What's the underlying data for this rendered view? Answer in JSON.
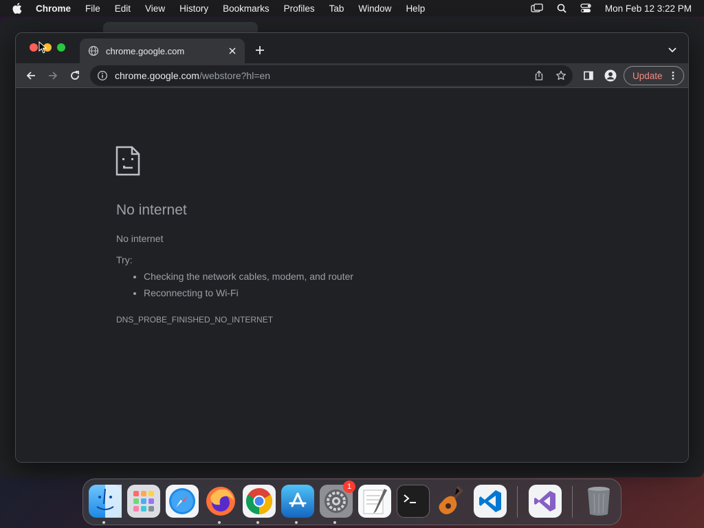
{
  "menubar": {
    "app_name": "Chrome",
    "items": [
      "File",
      "Edit",
      "View",
      "History",
      "Bookmarks",
      "Profiles",
      "Tab",
      "Window",
      "Help"
    ],
    "clock": "Mon Feb 12  3:22 PM"
  },
  "tab": {
    "title": "chrome.google.com",
    "favicon": "globe-icon"
  },
  "omnibox": {
    "host": "chrome.google.com",
    "path": "/webstore?hl=en"
  },
  "toolbar": {
    "update_label": "Update"
  },
  "error_page": {
    "icon": "sad-page-icon",
    "title": "No internet",
    "message": "No internet",
    "try_label": "Try:",
    "suggestions": [
      "Checking the network cables, modem, and router",
      "Reconnecting to Wi-Fi"
    ],
    "error_code": "DNS_PROBE_FINISHED_NO_INTERNET"
  },
  "dock": {
    "apps": [
      "Finder",
      "Launchpad",
      "Safari",
      "Firefox",
      "Chrome",
      "App Store",
      "System Settings",
      "TextEdit",
      "Terminal",
      "GarageBand",
      "Visual Studio Code",
      "Visual Studio",
      "Trash"
    ],
    "settings_badge": "1"
  },
  "colors": {
    "window_bg": "#202124",
    "toolbar_bg": "#35363a",
    "update_accent": "#f28b82",
    "close": "#ff5f57",
    "minimize": "#febc2e",
    "maximize": "#28c840"
  }
}
